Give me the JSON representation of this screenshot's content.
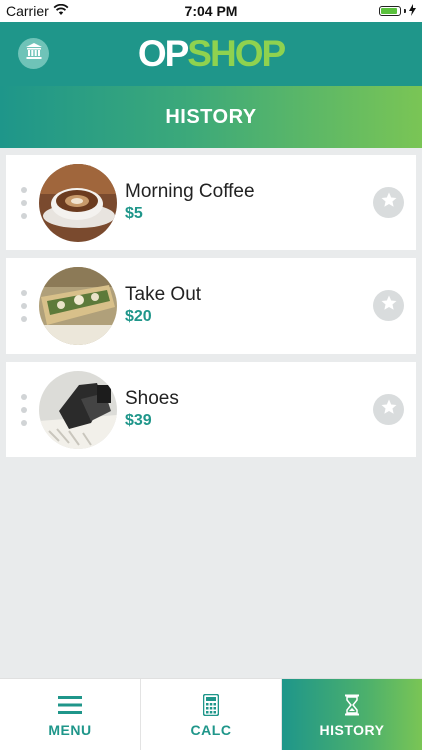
{
  "status_bar": {
    "carrier": "Carrier",
    "time": "7:04 PM"
  },
  "header": {
    "logo_op": "OP",
    "logo_shop": "SHOP",
    "title": "HISTORY",
    "left_icon": "bank-icon"
  },
  "history": {
    "items": [
      {
        "title": "Morning Coffee",
        "price": "$5",
        "image": "coffee-photo"
      },
      {
        "title": "Take Out",
        "price": "$20",
        "image": "takeout-photo"
      },
      {
        "title": "Shoes",
        "price": "$39",
        "image": "shoes-photo"
      }
    ]
  },
  "tabs": [
    {
      "label": "MENU",
      "icon": "hamburger-icon",
      "active": false
    },
    {
      "label": "CALC",
      "icon": "calculator-icon",
      "active": false
    },
    {
      "label": "HISTORY",
      "icon": "hourglass-icon",
      "active": true
    }
  ],
  "colors": {
    "brand_teal": "#1f968a",
    "brand_green": "#8fd24f",
    "background": "#e9ebec"
  }
}
